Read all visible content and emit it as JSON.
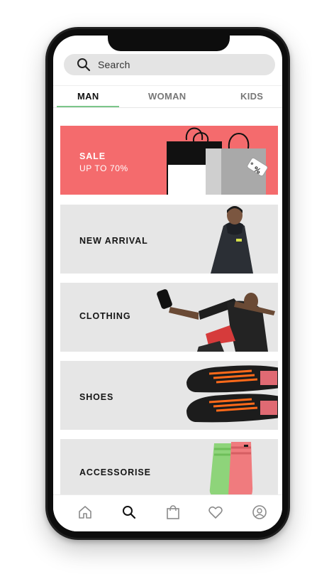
{
  "search": {
    "placeholder": "Search"
  },
  "tabs": [
    {
      "label": "MAN",
      "active": true
    },
    {
      "label": "WOMAN",
      "active": false
    },
    {
      "label": "KIDS",
      "active": false
    }
  ],
  "categories": [
    {
      "title": "SALE",
      "subtitle": "UP TO 70%",
      "tag_text": "%"
    },
    {
      "title": "NEW ARRIVAL"
    },
    {
      "title": "CLOTHING"
    },
    {
      "title": "SHOES"
    },
    {
      "title": "ACCESSORISE"
    }
  ],
  "colors": {
    "sale_background": "#f46b6d",
    "active_tab_underline": "#7cc68a",
    "card_background": "#e6e6e6"
  },
  "bottom_nav": [
    {
      "icon": "home-icon"
    },
    {
      "icon": "search-icon",
      "active": true
    },
    {
      "icon": "bag-icon"
    },
    {
      "icon": "heart-icon"
    },
    {
      "icon": "profile-icon"
    }
  ]
}
